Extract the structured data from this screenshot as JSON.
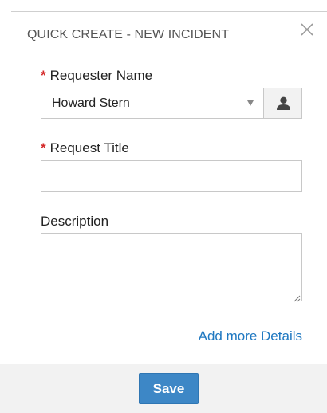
{
  "dialog": {
    "title": "QUICK CREATE - NEW INCIDENT",
    "close_icon": "close-icon"
  },
  "form": {
    "requester": {
      "required_mark": "*",
      "label": "Requester Name",
      "value": "Howard Stern",
      "dropdown_icon": "caret-down-icon",
      "lookup_icon": "user-icon"
    },
    "request_title": {
      "required_mark": "*",
      "label": "Request Title",
      "value": ""
    },
    "description": {
      "label": "Description",
      "value": ""
    },
    "more_details_link": "Add more Details"
  },
  "footer": {
    "save_label": "Save"
  },
  "colors": {
    "required": "#d42a2a",
    "link": "#1f78c1",
    "primary_button": "#3d87c6",
    "footer_background": "#f2f2f2"
  }
}
